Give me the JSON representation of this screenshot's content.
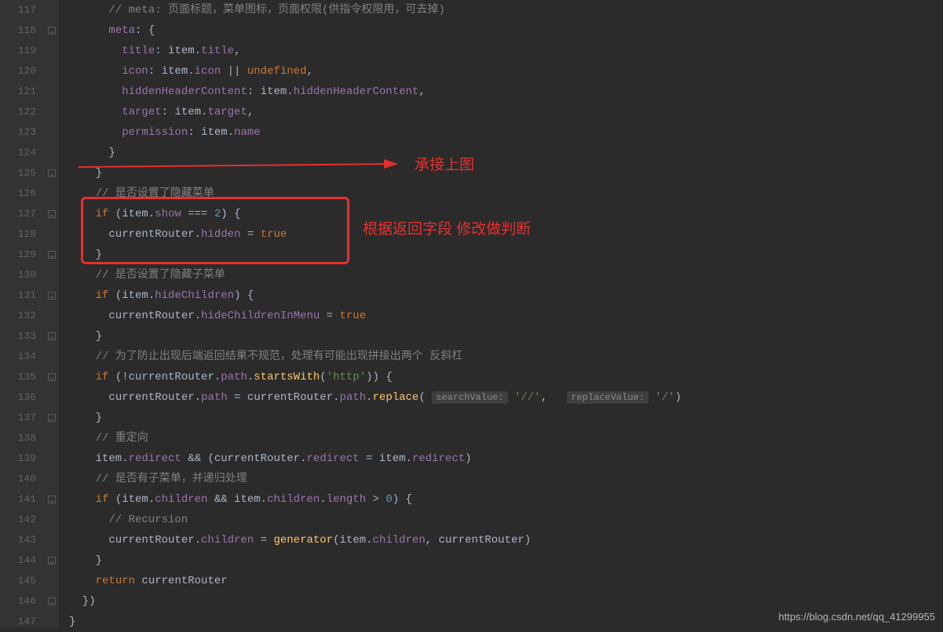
{
  "lineStart": 117,
  "lineEnd": 147,
  "annotations": {
    "arrowLabel": "承接上图",
    "boxLabel": "根据返回字段 修改做判断"
  },
  "watermark": "https://blog.csdn.net/qq_41299955",
  "paramHints": {
    "searchValue": "searchValue:",
    "replaceValue": "replaceValue:"
  },
  "code": {
    "117": "      // meta: 页面标题，菜单图标，页面权限(供指令权限用，可去掉)",
    "118": "      meta: {",
    "119": "        title: item.title,",
    "120": "        icon: item.icon || undefined,",
    "121": "        hiddenHeaderContent: item.hiddenHeaderContent,",
    "122": "        target: item.target,",
    "123": "        permission: item.name",
    "124": "      }",
    "125": "    }",
    "126": "    // 是否设置了隐藏菜单",
    "127": "    if (item.show === 2) {",
    "128": "      currentRouter.hidden = true",
    "129": "    }",
    "130": "    // 是否设置了隐藏子菜单",
    "131": "    if (item.hideChildren) {",
    "132": "      currentRouter.hideChildrenInMenu = true",
    "133": "    }",
    "134": "    // 为了防止出现后端返回结果不规范，处理有可能出现拼接出两个 反斜杠",
    "135": "    if (!currentRouter.path.startsWith('http')) {",
    "136": "      currentRouter.path = currentRouter.path.replace('//', '/')",
    "137": "    }",
    "138": "    // 重定向",
    "139": "    item.redirect && (currentRouter.redirect = item.redirect)",
    "140": "    // 是否有子菜单，并递归处理",
    "141": "    if (item.children && item.children.length > 0) {",
    "142": "      // Recursion",
    "143": "      currentRouter.children = generator(item.children, currentRouter)",
    "144": "    }",
    "145": "    return currentRouter",
    "146": "  })",
    "147": "}"
  },
  "foldMarks": [
    "118",
    "125",
    "127",
    "129",
    "131",
    "133",
    "135",
    "137",
    "141",
    "144",
    "146"
  ]
}
